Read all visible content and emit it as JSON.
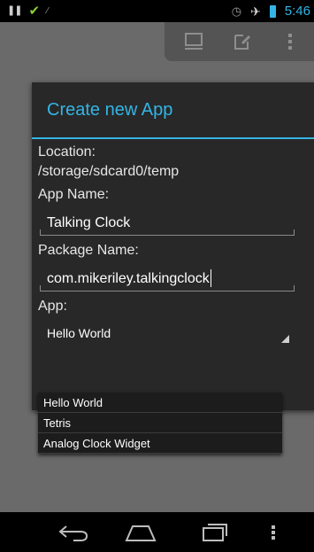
{
  "status_bar": {
    "time": "5:46",
    "icons": [
      "pause-icon",
      "check-icon",
      "notification-icon",
      "alarm-icon",
      "airplane-icon",
      "battery-icon"
    ]
  },
  "action_bar": {
    "icons": [
      "computer-icon",
      "edit-icon",
      "overflow-icon"
    ]
  },
  "dialog": {
    "title": "Create new App",
    "location_label": "Location:",
    "location_value": "/storage/sdcard0/temp",
    "app_name_label": "App Name:",
    "app_name_value": "Talking Clock",
    "package_name_label": "Package Name:",
    "package_name_value": "com.mikeriley.talkingclock",
    "app_label": "App:",
    "app_selected": "Hello World"
  },
  "dropdown": {
    "options": [
      "Hello World",
      "Tetris",
      "Analog Clock Widget"
    ]
  },
  "nav_bar": {
    "icons": [
      "back-icon",
      "home-icon",
      "recents-icon",
      "menu-icon"
    ]
  },
  "colors": {
    "accent": "#33b5e5",
    "check": "#8bd12d"
  }
}
